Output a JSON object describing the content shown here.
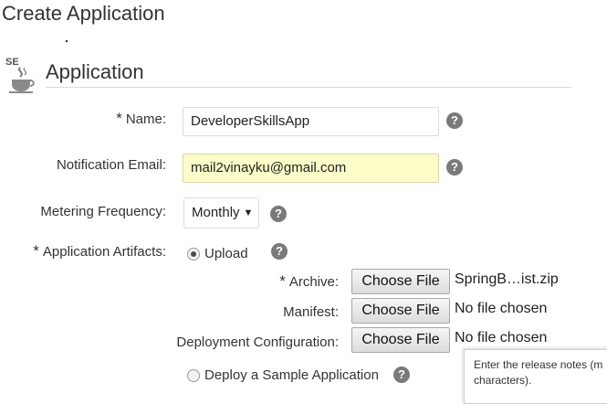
{
  "page": {
    "title": "Create Application"
  },
  "section": {
    "title": "Application",
    "icon": "java-se-icon",
    "icon_text": "SE"
  },
  "form": {
    "name": {
      "label": "Name:",
      "required_mark": "*",
      "value": "DeveloperSkillsApp"
    },
    "notification_email": {
      "label": "Notification Email:",
      "value": "mail2vinayku@gmail.com"
    },
    "metering_frequency": {
      "label": "Metering Frequency:",
      "selected": "Monthly",
      "arrow": "▼"
    },
    "artifacts": {
      "label": "Application Artifacts:",
      "required_mark": "*",
      "upload_option": "Upload",
      "upload_selected": true,
      "sample_option": "Deploy a Sample Application",
      "sample_selected": false
    },
    "archive": {
      "label": "Archive:",
      "required_mark": "*",
      "button": "Choose File",
      "status": "SpringB…ist.zip"
    },
    "manifest": {
      "label": "Manifest:",
      "button": "Choose File",
      "status": "No file chosen"
    },
    "deployment_config": {
      "label": "Deployment Configuration:",
      "button": "Choose File",
      "status": "No file chosen"
    }
  },
  "help_icon_glyph": "?",
  "tooltip": {
    "line1": "Enter the release notes (m",
    "line2": "characters)."
  },
  "colors": {
    "highlight_input": "#fcfcc8",
    "help_icon": "#7a7a7a",
    "text": "#333333"
  }
}
